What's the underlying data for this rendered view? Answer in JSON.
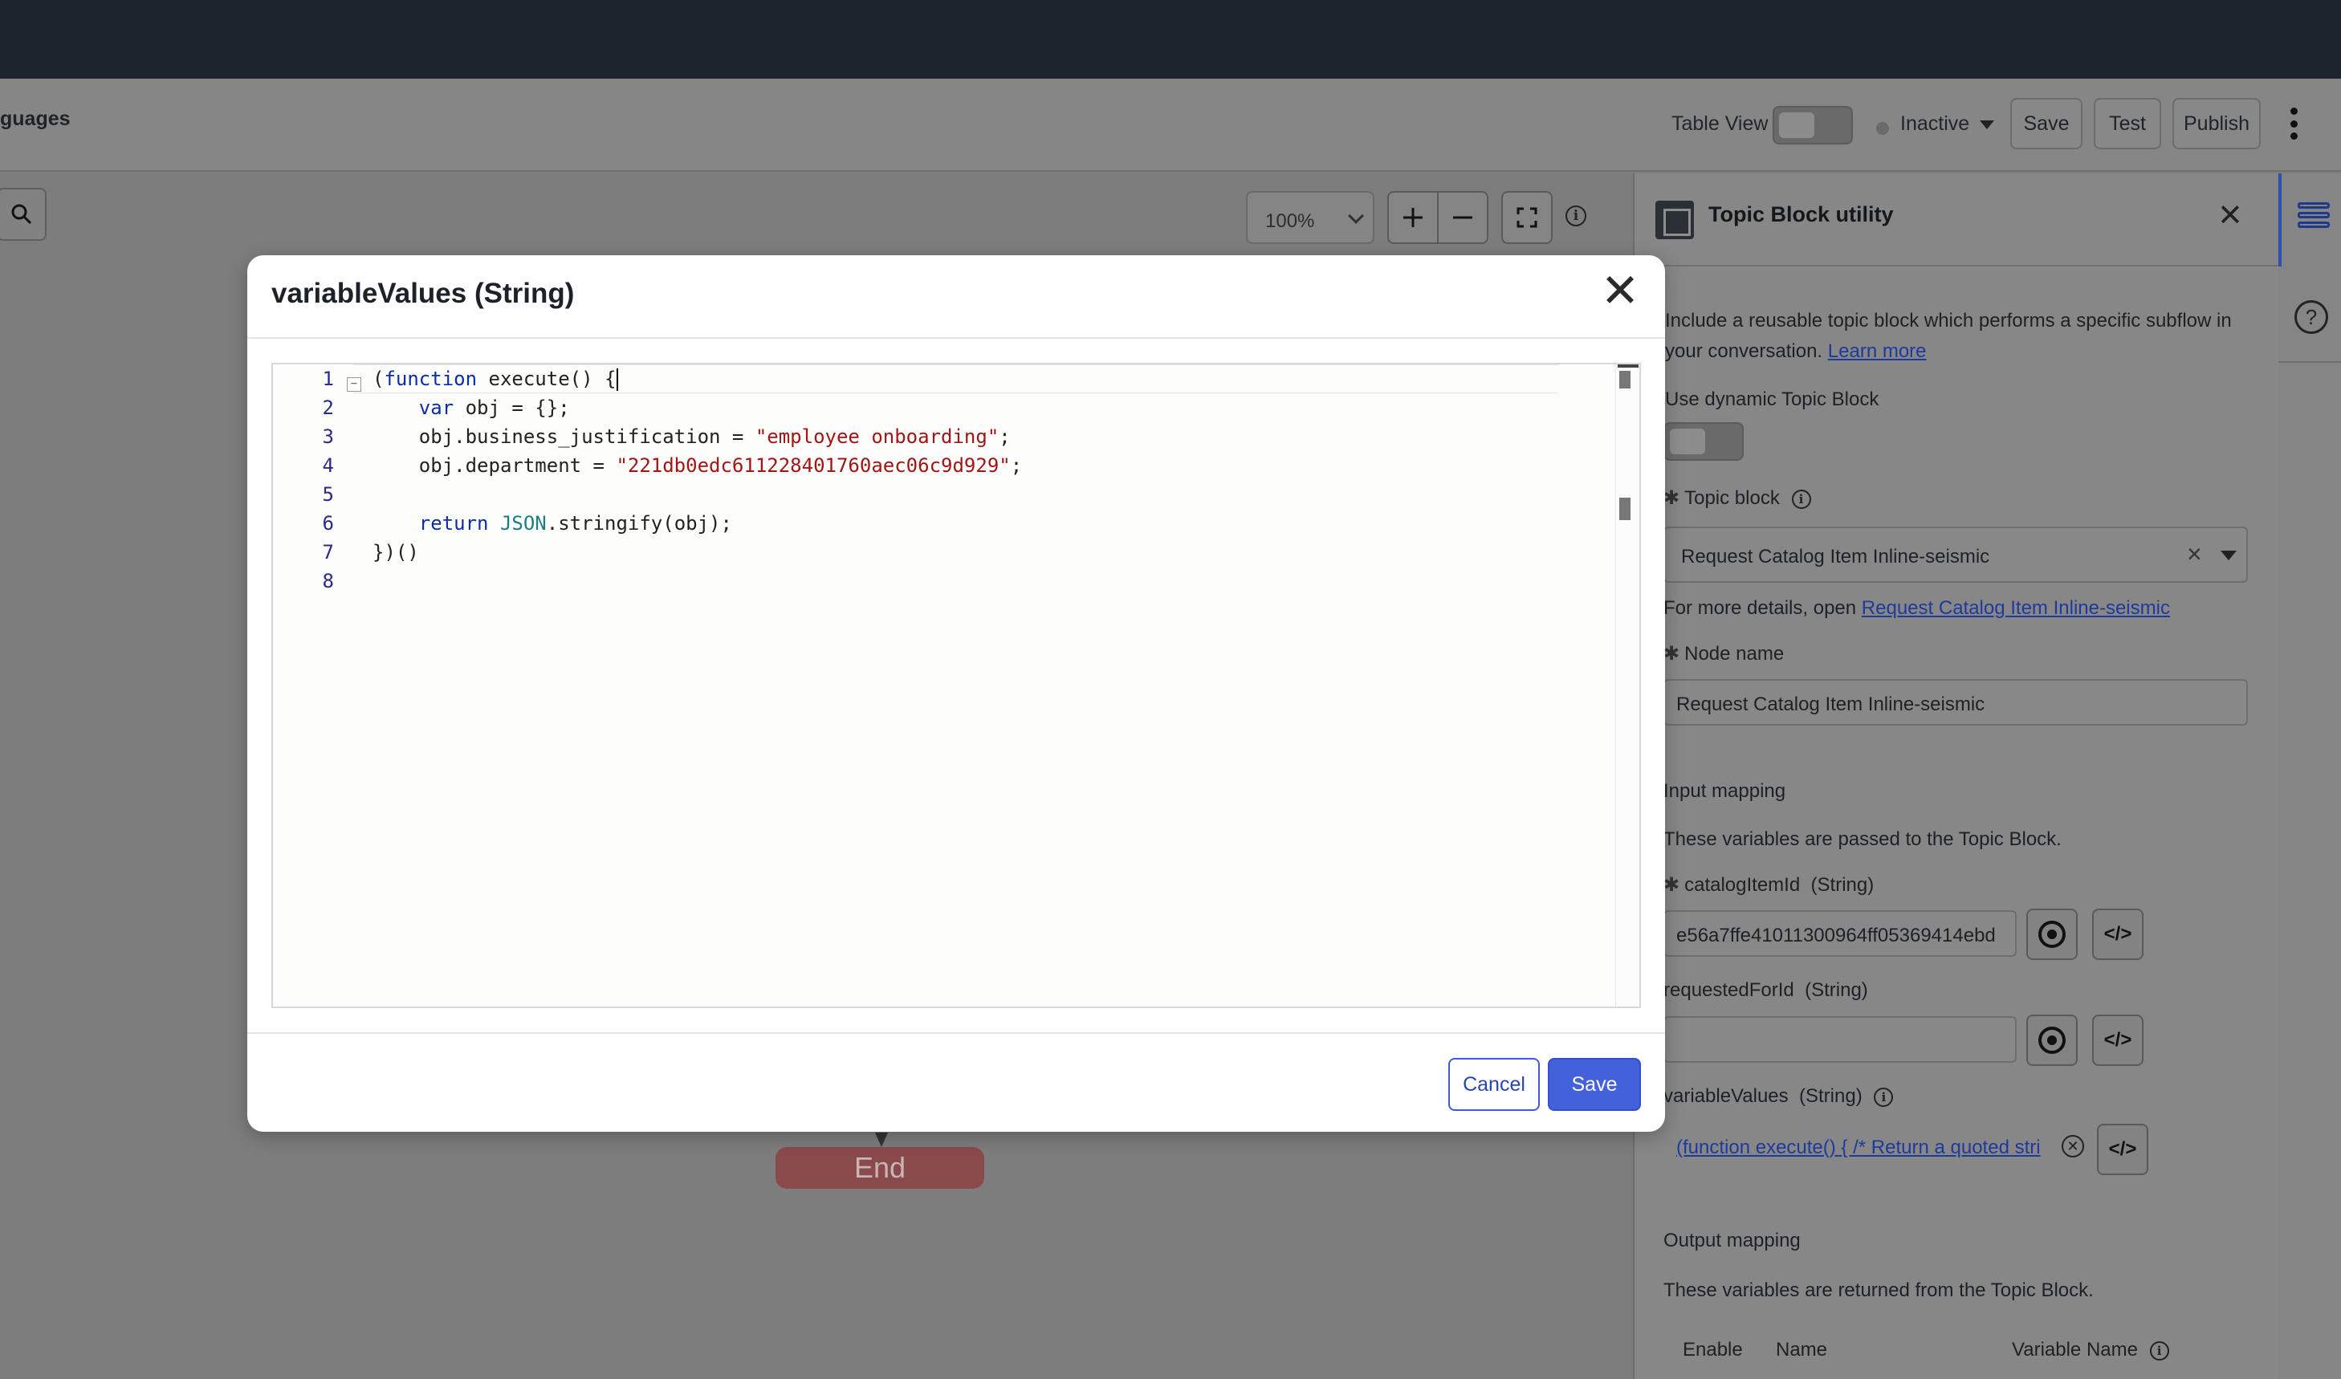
{
  "header": {
    "crumb": "guages",
    "table_view_label": "Table View",
    "status": "Inactive",
    "save_label": "Save",
    "test_label": "Test",
    "publish_label": "Publish"
  },
  "canvas": {
    "zoom": "100%",
    "end_node": "End"
  },
  "panel": {
    "title": "Topic Block utility",
    "description_line1": "Include a reusable topic block which performs a specific subflow in",
    "description_line2": "your conversation.",
    "learn_more": "Learn more",
    "dynamic_label": "Use dynamic Topic Block",
    "topic_block_label": "Topic block",
    "topic_block_value": "Request Catalog Item Inline-seismic",
    "details_prefix": "For more details, open",
    "details_link": "Request Catalog Item Inline-seismic",
    "node_name_label": "Node name",
    "node_name_value": "Request Catalog Item Inline-seismic",
    "input_mapping_title": "Input mapping",
    "input_mapping_desc": "These variables are passed to the Topic Block.",
    "catalog_label": "catalogItemId",
    "catalog_type": "(String)",
    "catalog_value": "e56a7ffe41011300964ff05369414ebd",
    "requested_label": "requestedForId",
    "requested_type": "(String)",
    "requested_value": "",
    "varvalues_label": "variableValues",
    "varvalues_type": "(String)",
    "varvalues_value": "(function execute() { /* Return a quoted stri",
    "output_mapping_title": "Output mapping",
    "output_mapping_desc": "These variables are returned from the Topic Block.",
    "col_enable": "Enable",
    "col_name": "Name",
    "col_variable_name": "Variable Name",
    "code_icon_label": "</>"
  },
  "modal": {
    "title": "variableValues (String)",
    "close_symbol": "✕",
    "cancel_label": "Cancel",
    "save_label": "Save",
    "line_numbers": [
      "1",
      "2",
      "3",
      "4",
      "5",
      "6",
      "7",
      "8"
    ],
    "code": {
      "l1_a": "(",
      "l1_kw": "function",
      "l1_b": " execute() {",
      "l2_indent": "    ",
      "l2_kw": "var",
      "l2_b": " obj = {};",
      "l3_a": "    obj.business_justification = ",
      "l3_str": "\"employee onboarding\"",
      "l3_b": ";",
      "l4_a": "    obj.department = ",
      "l4_str": "\"221db0edc611228401760aec06c9d929\"",
      "l4_b": ";",
      "l6_indent": "    ",
      "l6_kw": "return",
      "l6_sp": " ",
      "l6_glob": "JSON",
      "l6_b": ".stringify(obj);",
      "l7": "})()"
    }
  },
  "colors": {
    "accent": "#4361db",
    "keyword": "#0b2ea8",
    "string": "#a31515",
    "global": "#1a7f7f",
    "topbar": "#1d232d"
  },
  "icons": [
    "search-icon",
    "chevron-down-icon",
    "plus-icon",
    "minus-icon",
    "fit-screen-icon",
    "info-icon",
    "close-icon",
    "topic-block-icon",
    "target-icon",
    "code-icon",
    "clear-icon",
    "list-icon",
    "help-icon",
    "kebab-menu-icon",
    "fold-icon"
  ]
}
